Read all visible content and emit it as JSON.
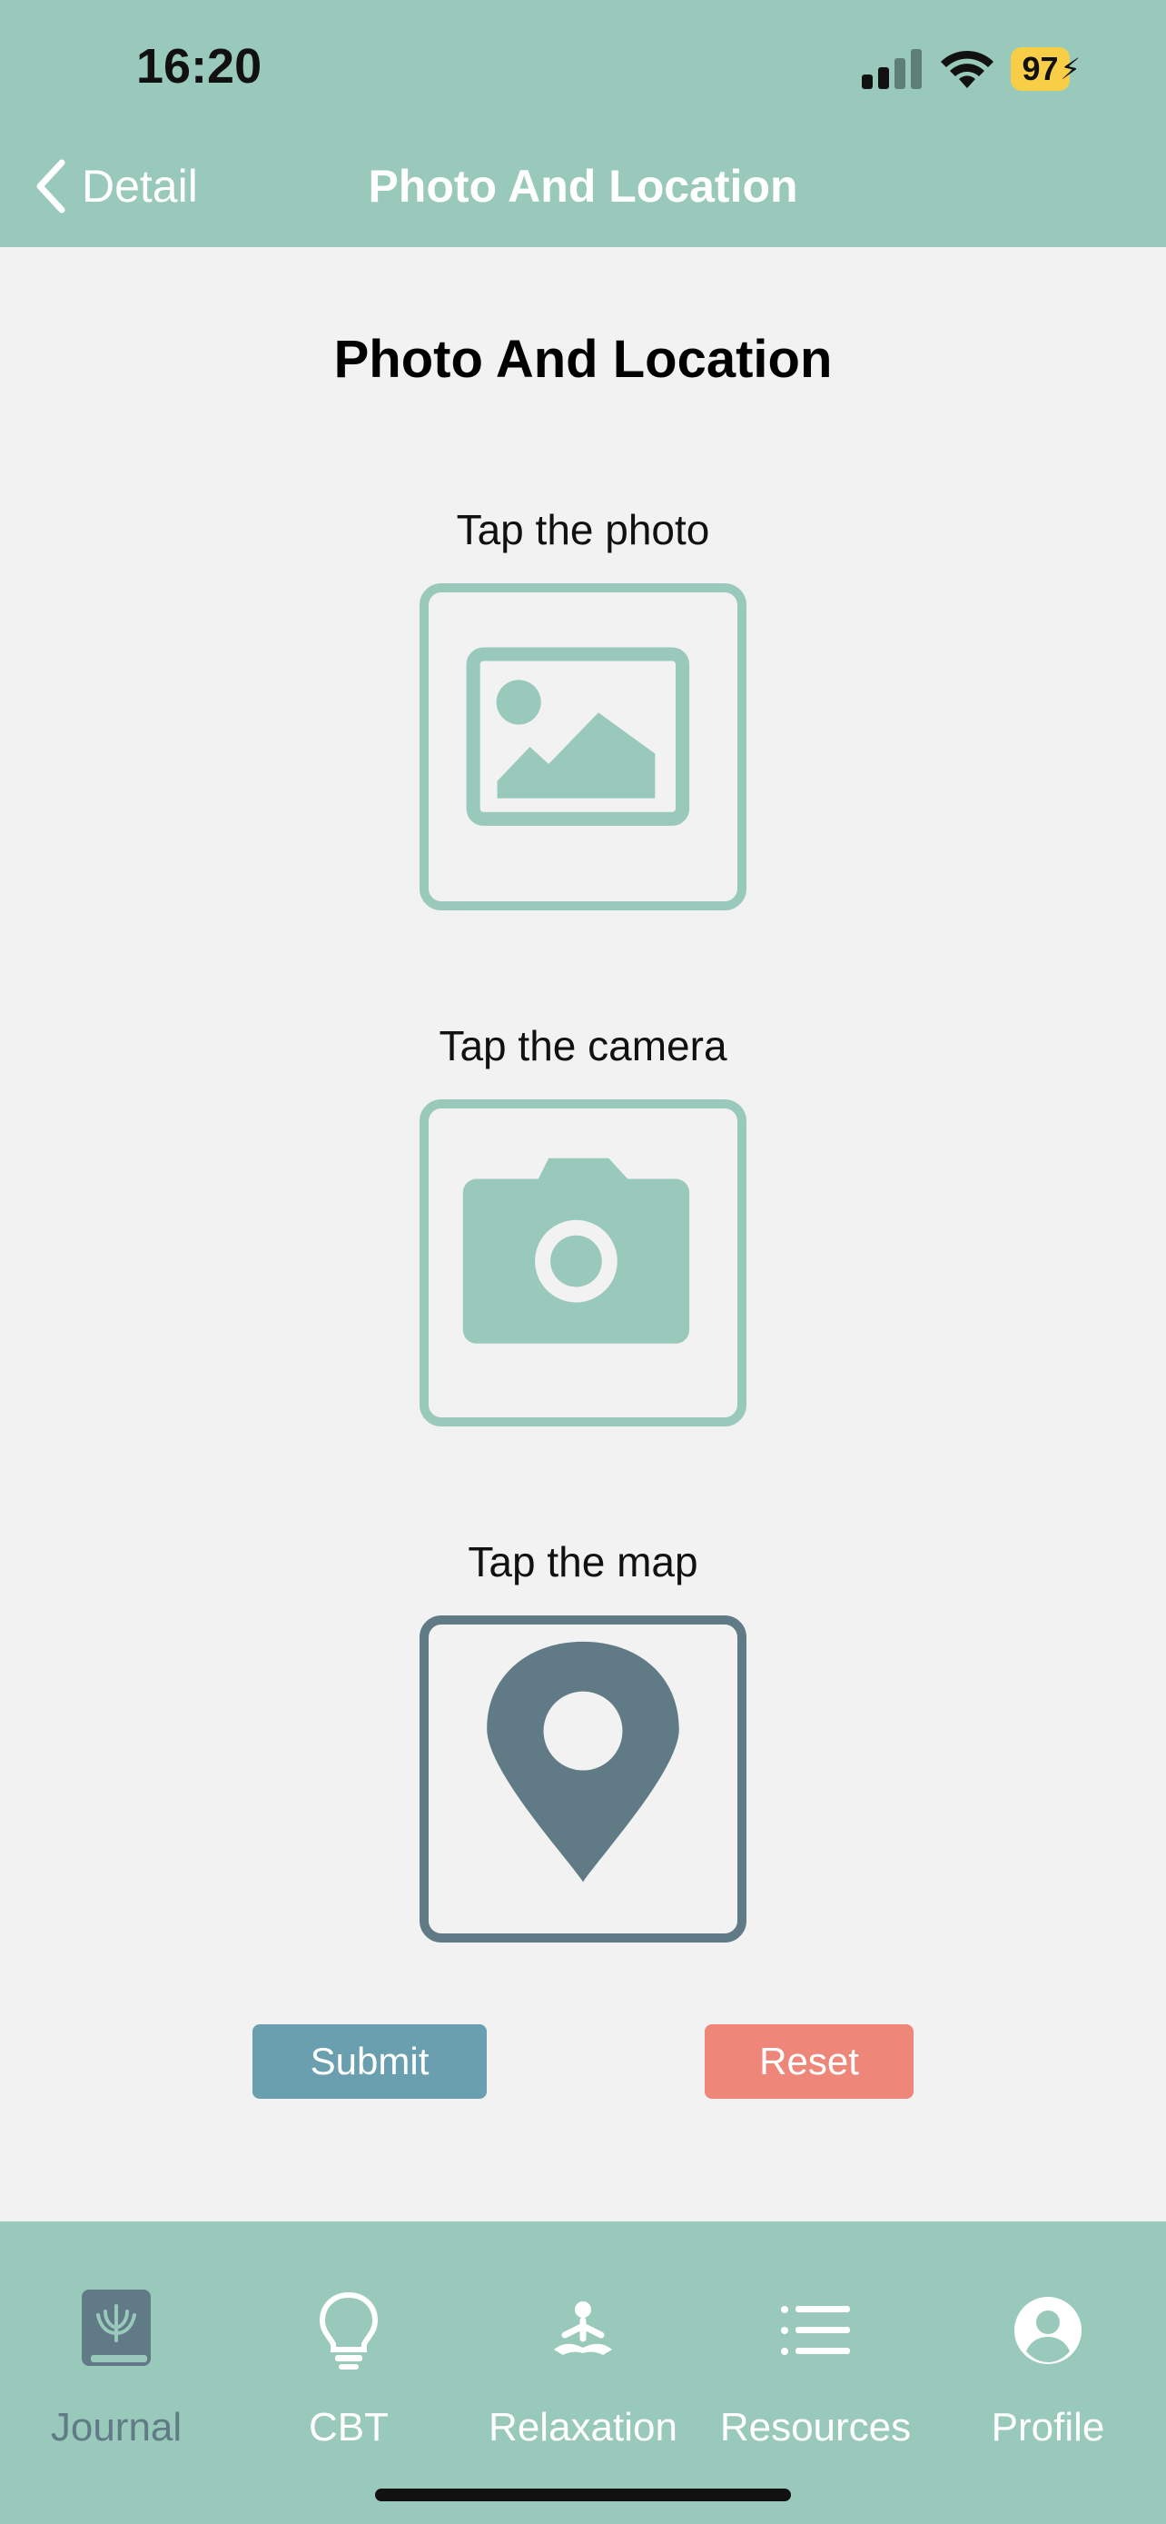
{
  "status_bar": {
    "time": "16:20",
    "battery": "97"
  },
  "nav": {
    "back_label": "Detail",
    "title": "Photo And Location"
  },
  "page": {
    "title": "Photo And Location"
  },
  "tiles": [
    {
      "label": "Tap the photo",
      "icon": "photo-icon"
    },
    {
      "label": "Tap the camera",
      "icon": "camera-icon"
    },
    {
      "label": "Tap the map",
      "icon": "map-pin-icon"
    }
  ],
  "actions": {
    "submit_label": "Submit",
    "reset_label": "Reset"
  },
  "tabbar": {
    "items": [
      {
        "label": "Journal",
        "icon": "journal-icon",
        "active": true
      },
      {
        "label": "CBT",
        "icon": "lightbulb-icon",
        "active": false
      },
      {
        "label": "Relaxation",
        "icon": "meditation-icon",
        "active": false
      },
      {
        "label": "Resources",
        "icon": "list-icon",
        "active": false
      },
      {
        "label": "Profile",
        "icon": "profile-icon",
        "active": false
      }
    ]
  },
  "colors": {
    "header": "#99c9ba",
    "accent_green": "#99c9ba",
    "accent_dark": "#607b85",
    "submit": "#699fae",
    "reset": "#ee877a",
    "background": "#f2f2f2"
  }
}
